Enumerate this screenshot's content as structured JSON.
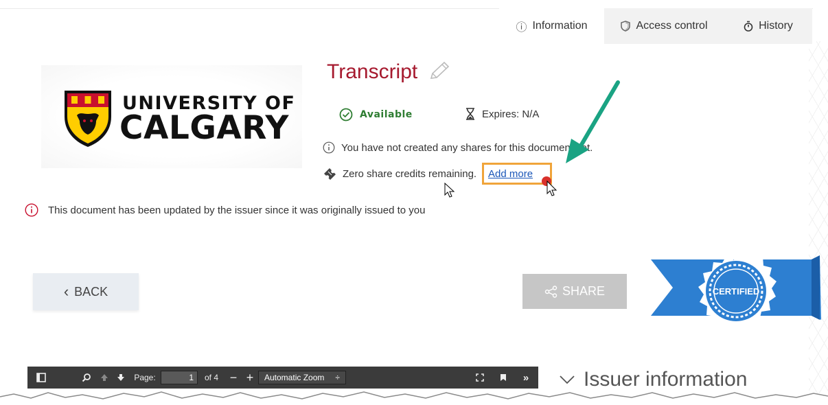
{
  "tabs": [
    {
      "label": "Information",
      "icon": "info-icon"
    },
    {
      "label": "Access control",
      "icon": "shield-icon"
    },
    {
      "label": "History",
      "icon": "stopwatch-icon"
    }
  ],
  "logo": {
    "line1": "UNIVERSITY OF",
    "line2": "CALGARY"
  },
  "document": {
    "title": "Transcript",
    "status": "Available",
    "expires": "Expires: N/A",
    "no_shares_note": "You have not created any shares for this document yet.",
    "credits_text": "Zero share credits remaining.",
    "add_more_link": "Add more",
    "updated_warning": "This document has been updated by the issuer since it was originally issued to you"
  },
  "buttons": {
    "back": "BACK",
    "share": "SHARE"
  },
  "badge": {
    "text": "CERTIFIED"
  },
  "pdf_viewer": {
    "page_label": "Page:",
    "page_value": "1",
    "page_total": "of 4",
    "zoom_value": "Automatic Zoom"
  },
  "issuer_section": {
    "title": "Issuer information"
  },
  "colors": {
    "title_red": "#a6192e",
    "available_green": "#2e7d32",
    "link_blue": "#1a56b8",
    "highlight_orange": "#f0a43a",
    "annotation_arrow": "#1aa383",
    "ribbon_blue": "#2d7fd1"
  }
}
